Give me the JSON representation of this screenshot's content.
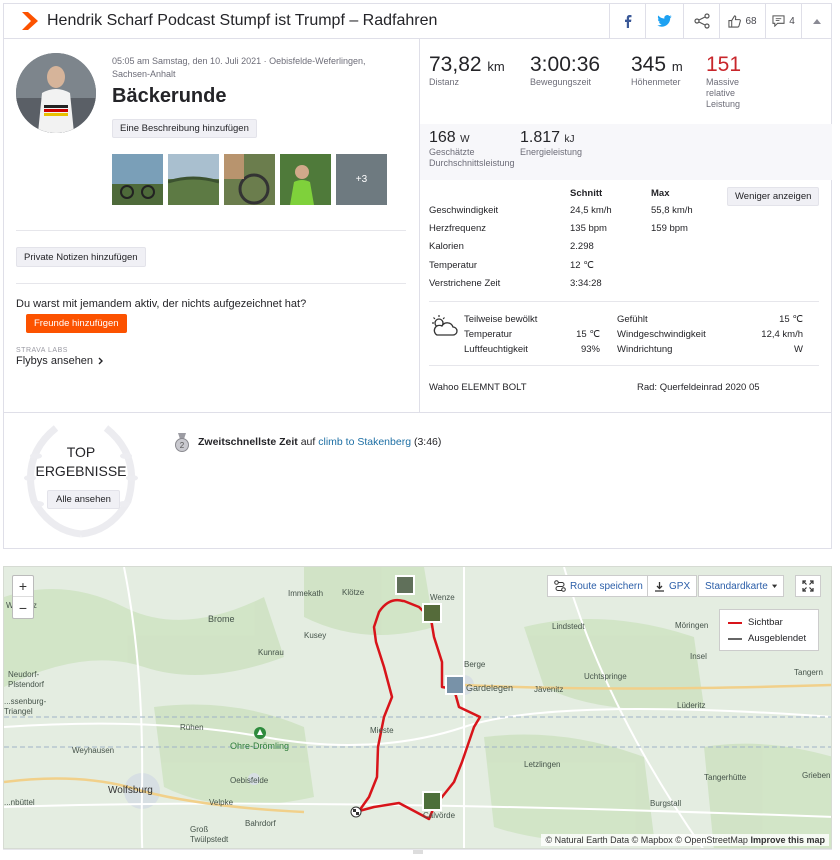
{
  "header": {
    "title": "Hendrik Scharf Podcast Stumpf ist Trumpf – Radfahren",
    "kudos_count": "68",
    "comments_count": "4"
  },
  "activity": {
    "datetime": "05:05 am Samstag, den 10. Juli 2021 · Oebisfelde-Weferlingen,",
    "location2": "Sachsen-Anhalt",
    "name": "Bäckerunde",
    "add_description": "Eine Beschreibung hinzufügen",
    "photos_more": "+3",
    "private_notes": "Private Notizen hinzufügen",
    "with_someone": "Du warst mit jemandem aktiv, der nichts aufgezeichnet hat?",
    "add_friends": "Freunde hinzufügen",
    "labs": "STRAVA LABS",
    "flybys": "Flybys ansehen"
  },
  "stats": {
    "distance": {
      "value": "73,82",
      "unit": "km",
      "label": "Distanz"
    },
    "moving_time": {
      "value": "3:00:36",
      "label": "Bewegungszeit"
    },
    "elevation": {
      "value": "345",
      "unit": "m",
      "label": "Höhenmeter"
    },
    "relative_effort": {
      "value": "151",
      "label1": "Massive",
      "label2": "relative",
      "label3": "Leistung"
    },
    "power": {
      "value": "168",
      "unit": "W",
      "label1": "Geschätzte",
      "label2": "Durchschnittsleistung"
    },
    "energy": {
      "value": "1.817",
      "unit": "kJ",
      "label": "Energieleistung"
    }
  },
  "table": {
    "col_avg": "Schnitt",
    "col_max": "Max",
    "show_less": "Weniger anzeigen",
    "rows": [
      {
        "label": "Geschwindigkeit",
        "avg": "24,5 km/h",
        "max": "55,8 km/h"
      },
      {
        "label": "Herzfrequenz",
        "avg": "135 bpm",
        "max": "159 bpm"
      },
      {
        "label": "Kalorien",
        "avg": "2.298",
        "max": ""
      },
      {
        "label": "Temperatur",
        "avg": "12 ℃",
        "max": ""
      },
      {
        "label": "Verstrichene Zeit",
        "avg": "3:34:28",
        "max": ""
      }
    ]
  },
  "weather": {
    "condition": "Teilweise bewölkt",
    "temp_label": "Temperatur",
    "temp": "15 ℃",
    "humidity_label": "Luftfeuchtigkeit",
    "humidity": "93%",
    "feels_label": "Gefühlt",
    "feels": "15 ℃",
    "wind_label": "Windgeschwindigkeit",
    "wind": "12,4 km/h",
    "dir_label": "Windrichtung",
    "dir": "W"
  },
  "device": {
    "name": "Wahoo ELEMNT BOLT",
    "bike": "Rad: Querfeldeinrad 2020 05"
  },
  "results": {
    "top1": "TOP",
    "top2": "ERGEBNISSE",
    "see_all": "Alle ansehen",
    "achievement_bold": "Zweitschnellste Zeit",
    "achievement_on": "auf",
    "segment": "climb to Stakenberg",
    "segment_time": "(3:46)"
  },
  "map": {
    "save_route": "Route speichern",
    "gpx": "GPX",
    "style": "Standardkarte",
    "legend_visible": "Sichtbar",
    "legend_hidden": "Ausgeblendet",
    "zoom_in": "+",
    "zoom_out": "−",
    "attribution": "© Natural Earth Data © Mapbox © OpenStreetMap",
    "improve": "Improve this map",
    "towns": [
      "Klötze",
      "Immekath",
      "Brome",
      "Kusey",
      "Kunrau",
      "Wenze",
      "Berge",
      "Gardelegen",
      "Jävenitz",
      "Lindstedt",
      "Möringen",
      "Insel",
      "Uchtspringe",
      "Lüderitz",
      "Tangern",
      "Neudorf-Plstendorf",
      "Rühen",
      "Weyhausen",
      "Wolfsburg",
      "Ohre-Drömling",
      "Mieste",
      "Oebisfelde",
      "Velpke",
      "Bahrdorf",
      "Groß Twülpstedt",
      "Letzlingen",
      "Tangerhütte",
      "Burgstall",
      "Grieben",
      "Calvörde",
      "Wa..holz",
      "...ssenburg-Triangel",
      "...nbüttel"
    ]
  },
  "colors": {
    "brand": "#fc5200",
    "route": "#d8141a",
    "effort": "#c8262b",
    "link": "#1d6fa4"
  }
}
